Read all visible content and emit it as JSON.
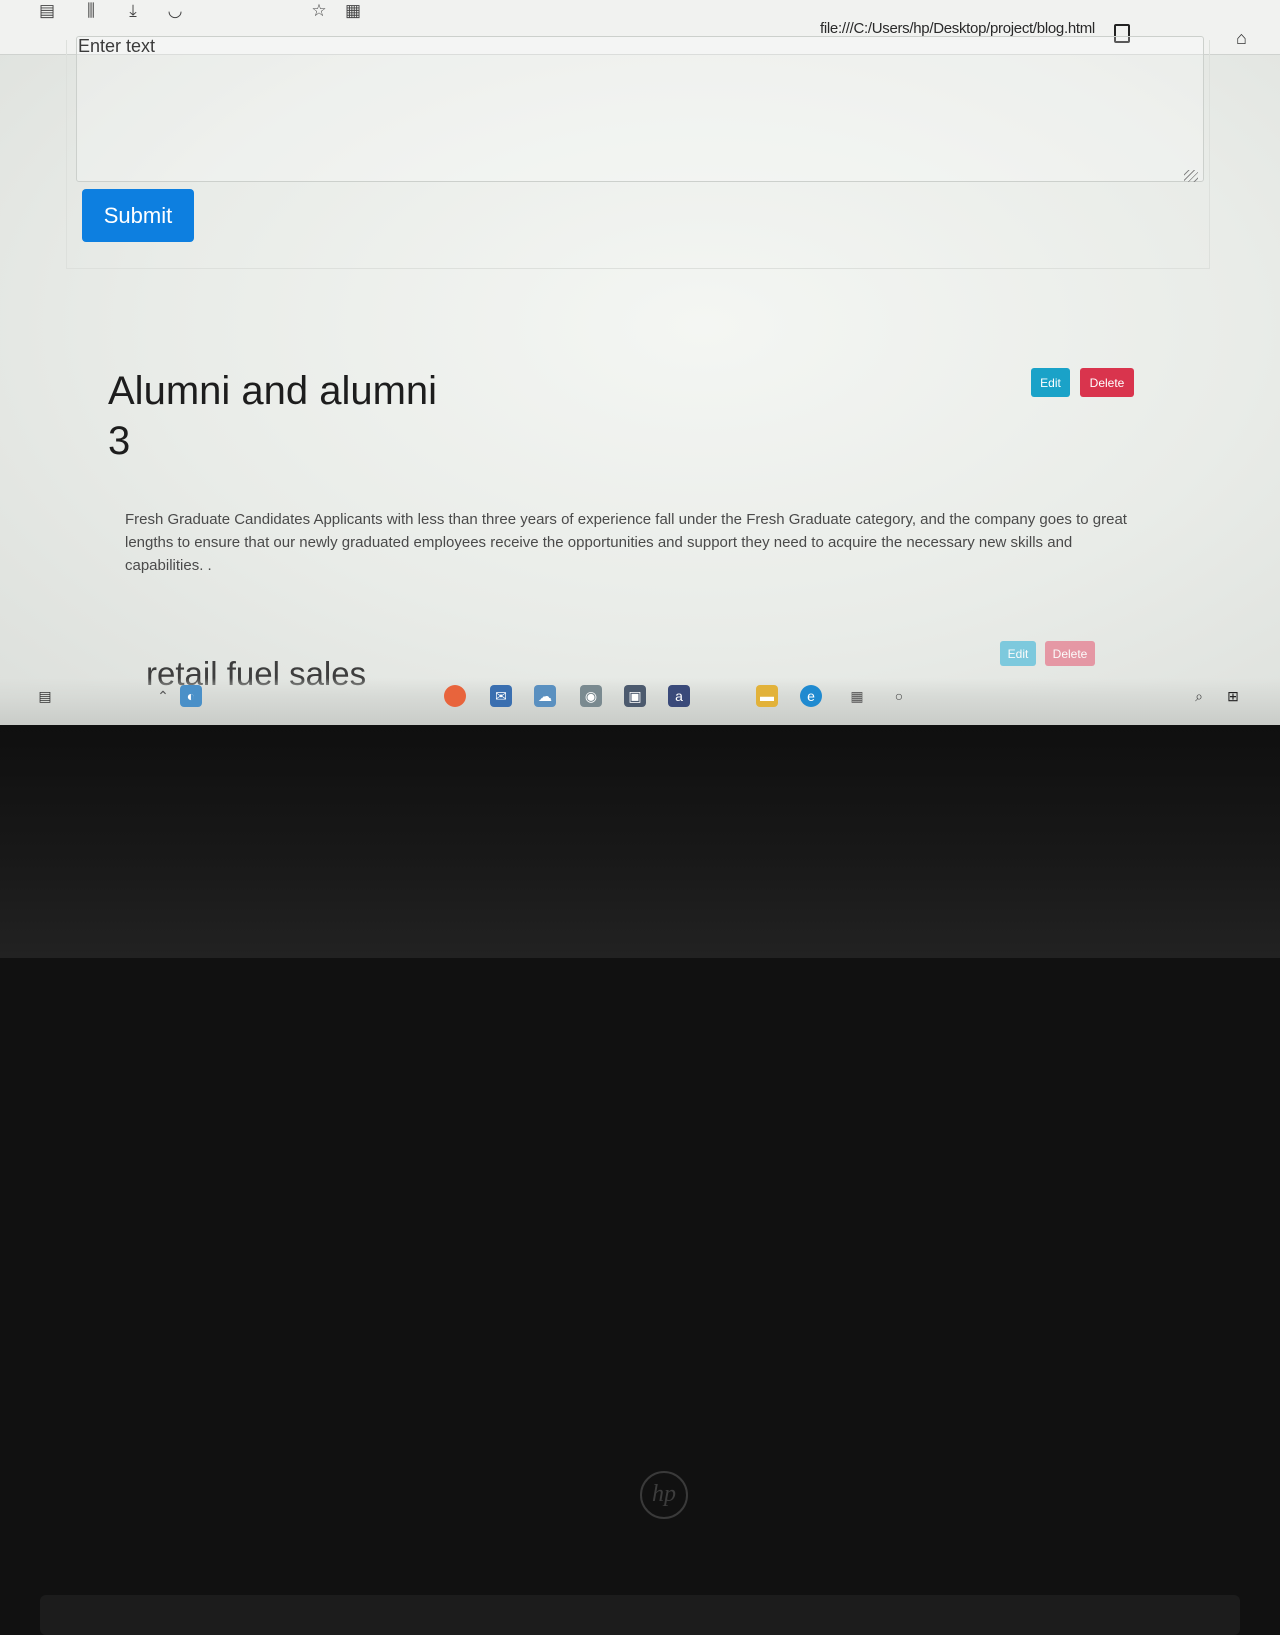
{
  "browser": {
    "url": "file:///C:/Users/hp/Desktop/project/blog.html",
    "toolbar_icons": [
      "reader-icon",
      "library-icon",
      "download-icon",
      "pocket-icon",
      "bookmark-star-icon",
      "reader-mode-icon",
      "page-icon",
      "home-icon"
    ]
  },
  "form": {
    "textarea_placeholder": "Enter text",
    "submit_label": "Submit"
  },
  "posts": [
    {
      "title": "Alumni and alumni",
      "subtitle": "3",
      "edit_label": "Edit",
      "delete_label": "Delete",
      "body": "Fresh Graduate Candidates Applicants with less than three years of experience fall under the Fresh Graduate category, and the company goes to great lengths to ensure that our newly graduated employees receive the opportunities and support they need to acquire the necessary new skills and capabilities. ."
    },
    {
      "title": "retail fuel sales",
      "edit_label": "Edit",
      "delete_label": "Delete"
    }
  ],
  "taskbar": {
    "icons": [
      "windows-start-icon",
      "search-icon",
      "task-view-icon",
      "widgets-icon",
      "edge-icon",
      "file-explorer-icon",
      "amazon-icon",
      "store-icon",
      "camera-icon",
      "weather-icon",
      "mail-icon",
      "firefox-icon",
      "network-icon",
      "chevron-up-icon",
      "notification-icon"
    ]
  },
  "colors": {
    "submit_button": "#0d7fe0",
    "edit_button": "#1aa2c8",
    "delete_button": "#d9344d"
  },
  "device": {
    "brand": "hp"
  }
}
